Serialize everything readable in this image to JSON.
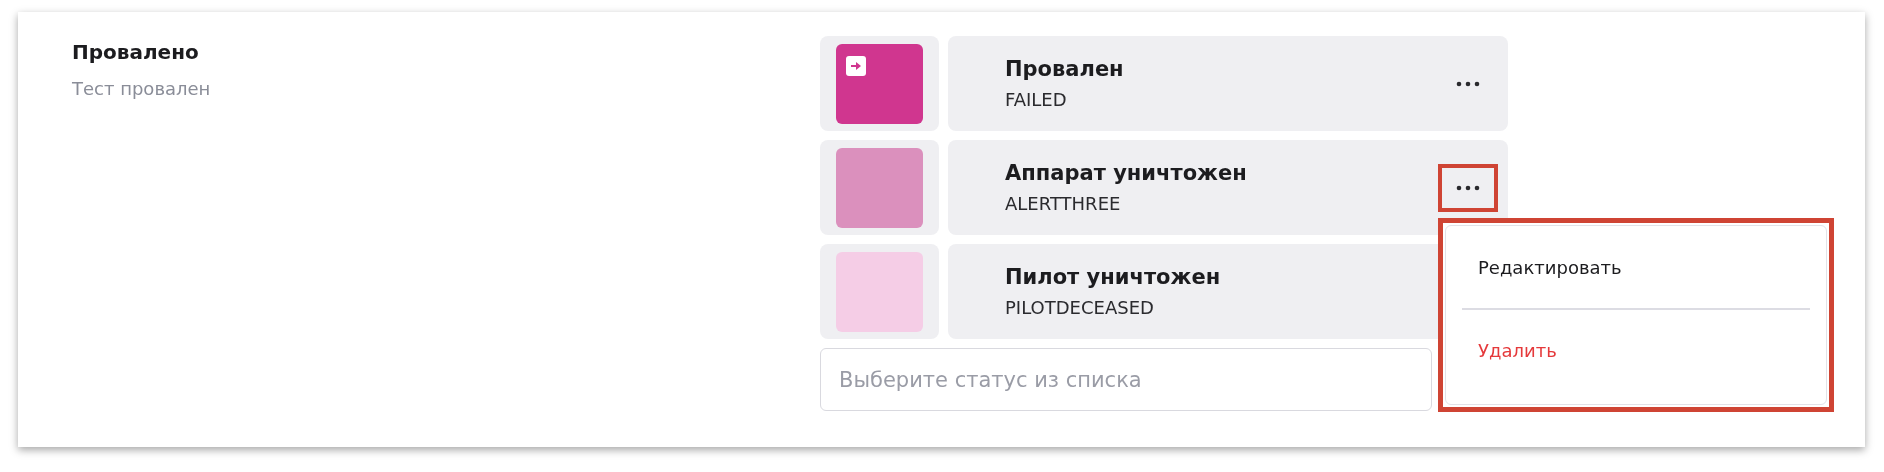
{
  "section": {
    "title": "Провалено",
    "description": "Тест провален"
  },
  "statuses": [
    {
      "name": "Провален",
      "code": "FAILED",
      "color": "#d0368f",
      "has_icon": true,
      "menu_button": {
        "highlighted": false
      }
    },
    {
      "name": "Аппарат уничтожен",
      "code": "ALERTTHREE",
      "color": "#db90bd",
      "has_icon": false,
      "menu_button": {
        "highlighted": true
      }
    },
    {
      "name": "Пилот уничтожен",
      "code": "PILOTDECEASED",
      "color": "#f5cde6",
      "has_icon": false
    }
  ],
  "status_select": {
    "placeholder": "Выберите статус из списка"
  },
  "context_menu": {
    "highlighted": true,
    "items": [
      {
        "label": "Редактировать",
        "kind": "normal"
      },
      {
        "label": "Удалить",
        "kind": "danger"
      }
    ]
  }
}
